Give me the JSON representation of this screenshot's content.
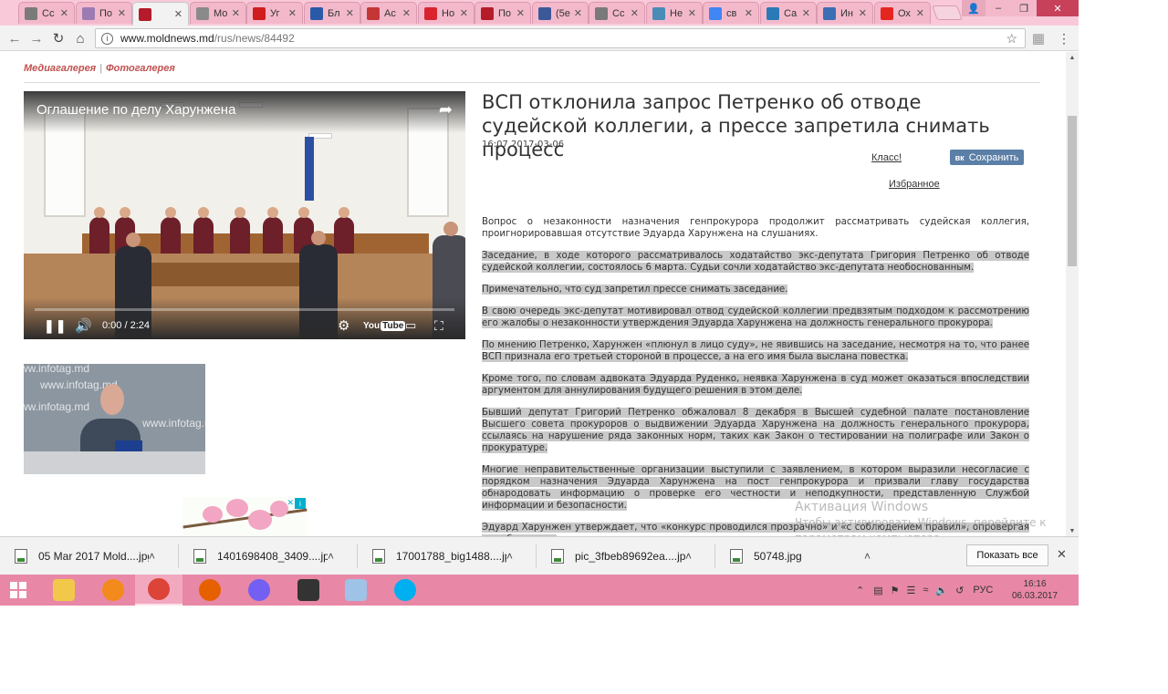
{
  "browser": {
    "tabs": [
      {
        "label": "Сс",
        "favicon": "generic-favicon",
        "color": "#7a7a7a"
      },
      {
        "label": "По",
        "favicon": "mail-favicon",
        "color": "#9c7bb3"
      },
      {
        "label": "",
        "favicon": "moldnews-favicon",
        "color": "#b51c2a",
        "active": true
      },
      {
        "label": "Мо",
        "favicon": "document-favicon",
        "color": "#8a8a8a"
      },
      {
        "label": "Уг",
        "favicon": "rtr-favicon",
        "color": "#d01d1d"
      },
      {
        "label": "Бл",
        "favicon": "b-favicon",
        "color": "#2a5aa7"
      },
      {
        "label": "Ас",
        "favicon": "arrow-favicon",
        "color": "#c43636"
      },
      {
        "label": "Но",
        "favicon": "nm-favicon",
        "color": "#d9242e"
      },
      {
        "label": "По",
        "favicon": "m-favicon",
        "color": "#b51c2a"
      },
      {
        "label": "(5е",
        "favicon": "facebook-favicon",
        "color": "#3b5998"
      },
      {
        "label": "Сс",
        "favicon": "generic-favicon",
        "color": "#7a7a7a"
      },
      {
        "label": "Не",
        "favicon": "globe-favicon",
        "color": "#4a8bb8"
      },
      {
        "label": "св",
        "favicon": "google-favicon",
        "color": "#4285f4"
      },
      {
        "label": "Са",
        "favicon": "earth-favicon",
        "color": "#2b7ab8"
      },
      {
        "label": "Ин",
        "favicon": "fedora-favicon",
        "color": "#3c6eb4"
      },
      {
        "label": "Ох",
        "favicon": "yandex-favicon",
        "color": "#e52620"
      }
    ],
    "url_host": "www.moldnews.md",
    "url_path": "/rus/news/84492"
  },
  "page": {
    "gallery_links": {
      "media": "Медиагалерея",
      "separator": "|",
      "photo": "Фотогалерея"
    },
    "video": {
      "title": "Оглашение по делу Харунжена",
      "time": "0:00 / 2:24",
      "progress": 0.0,
      "youtube_label": "You",
      "youtube_box": "Tube"
    },
    "thumb_watermark": [
      "ww.infotag.md",
      "www.infotag.md",
      "ww.infotag.md",
      "www.infotag.md"
    ],
    "headline": "ВСП отклонила запрос Петренко об отводе судейской коллегии, а прессе запретила снимать процесс",
    "pubdate": "16:07 2017-03-06",
    "social": {
      "klass": "Класс!",
      "vk_logo": "вк",
      "vk_save": "Сохранить",
      "favorites": "Избранное"
    },
    "paragraphs": [
      {
        "text": "Вопрос о незаконности назначения генпрокурора продолжит рассматривать судейская коллегия, проигнорировавшая отсутствие Эдуарда Харунжена на слушаниях.",
        "highlight": false
      },
      {
        "text": "Заседание, в ходе которого рассматривалось ходатайство экс-депутата Григория Петренко об отводе судейской коллегии, состоялось 6 марта. Судьи сочли ходатайство экс-депутата необоснованным.",
        "highlight": true
      },
      {
        "text": "Примечательно, что суд запретил прессе снимать заседание.",
        "highlight": true
      },
      {
        "text": "В свою очередь экс-депутат мотивировал отвод судейской коллегии предвзятым подходом к рассмотрению его жалобы о незаконности утверждения Эдуарда Харунжена на должность генерального прокурора.",
        "highlight": true
      },
      {
        "text": "По мнению Петренко, Харунжен «плюнул в лицо суду», не явившись на заседание, несмотря на то, что ранее ВСП признала его третьей стороной в процессе, а на его имя была выслана повестка.",
        "highlight": true
      },
      {
        "text": "Кроме того, по словам адвоката Эдуарда Руденко, неявка Харунжена в суд может оказаться впоследствии аргументом для аннулирования будущего решения в этом деле.",
        "highlight": true
      },
      {
        "text": "Бывший депутат Григорий Петренко обжаловал 8 декабря в Высшей судебной палате постановление Высшего совета прокуроров о выдвижении Эдуарда Харунжена на должность генерального прокурора, ссылаясь на нарушение ряда законных норм, таких как Закон о тестировании на полиграфе или Закон о прокуратуре.",
        "highlight": true
      },
      {
        "text": "Многие неправительственные организации выступили с заявлением, в котором выразили несогласие с порядком назначения Эдуарда Харунжена на пост генпрокурора и призвали главу государства обнародовать информацию о проверке его честности и неподкупности, представленную Службой информации и безопасности.",
        "highlight": true
      },
      {
        "text": "Эдуард Харунжен утверждает, что «конкурс проводился прозрачно» и «с соблюдением правил», опровергая все обвинения.",
        "highlight": true
      }
    ],
    "activation": {
      "line1": "Активация Windows",
      "line2": "Чтобы активировать Windows, перейдите к параметрам компьютера."
    }
  },
  "downloads": {
    "items": [
      "05 Mar 2017 Mold....jpg",
      "1401698408_3409....jpg",
      "17001788_big1488....jpg",
      "pic_3fbeb89692ea....jpg",
      "50748.jpg"
    ],
    "show_all": "Показать все"
  },
  "taskbar": {
    "apps": [
      {
        "name": "file-explorer-icon",
        "color": "#f2c84b"
      },
      {
        "name": "browser-orange-icon",
        "color": "#f28a1c"
      },
      {
        "name": "chrome-icon",
        "color": "#db4437",
        "active": true
      },
      {
        "name": "firefox-icon",
        "color": "#e66000"
      },
      {
        "name": "viber-icon",
        "color": "#7360f2"
      },
      {
        "name": "camera-icon",
        "color": "#333333"
      },
      {
        "name": "paint-icon",
        "color": "#9ec3e6"
      },
      {
        "name": "skype-icon",
        "color": "#00aff0"
      }
    ],
    "lang": "РУС",
    "time": "16:16",
    "date": "06.03.2017"
  }
}
